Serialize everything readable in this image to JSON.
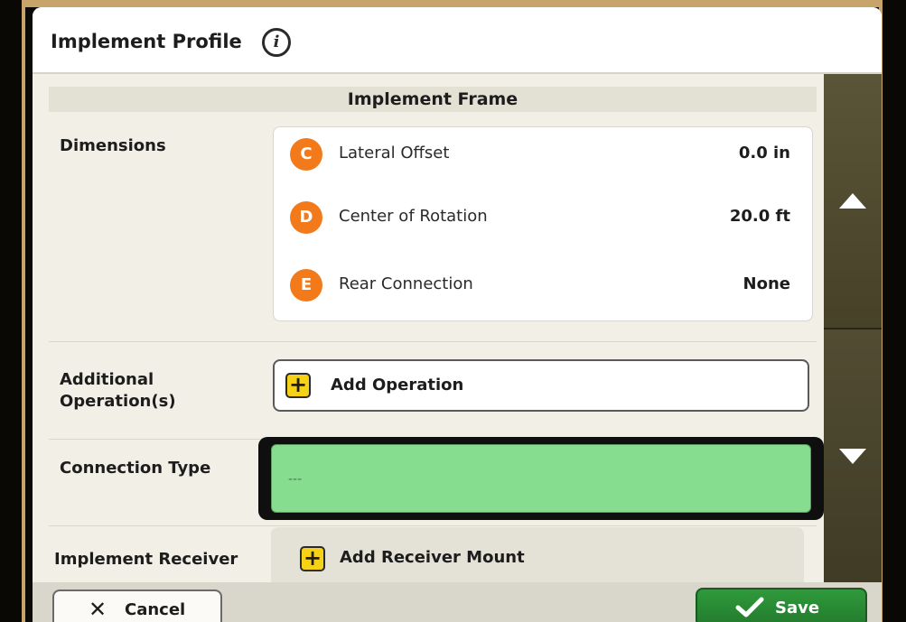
{
  "header": {
    "title": "Implement Profile",
    "info_icon": "info-icon"
  },
  "section": {
    "title": "Implement Frame"
  },
  "dimensions": {
    "label": "Dimensions",
    "rows": [
      {
        "letter": "C",
        "name": "Lateral Offset",
        "value": "0.0 in"
      },
      {
        "letter": "D",
        "name": "Center of Rotation",
        "value": "20.0 ft"
      },
      {
        "letter": "E",
        "name": "Rear Connection",
        "value": "None"
      }
    ],
    "letter_color": "#f27a1a"
  },
  "operations": {
    "label_line1": "Additional",
    "label_line2": "Operation(s)",
    "button_label": "Add Operation"
  },
  "connection": {
    "label": "Connection Type",
    "value": "---",
    "field_color": "#86dc8f"
  },
  "receiver": {
    "label": "Implement Receiver",
    "button_label": "Add Receiver Mount"
  },
  "scroll": {
    "up_icon": "arrow-up-icon",
    "down_icon": "arrow-down-icon"
  },
  "footer": {
    "cancel_label": "Cancel",
    "save_label": "Save",
    "save_color": "#2f9a3b"
  }
}
